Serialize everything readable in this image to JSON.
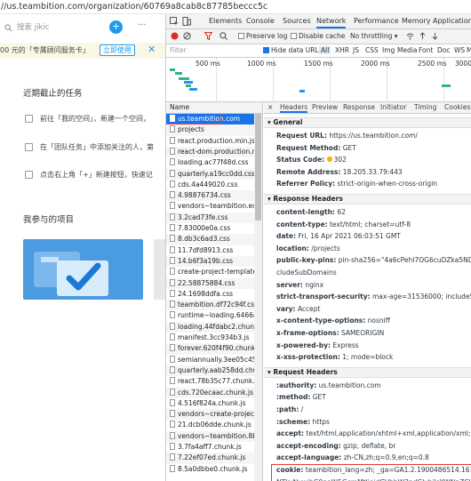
{
  "browser": {
    "url_fragment": "//us.teambition.com/organization/60769a8cab8c87785beccc5c"
  },
  "page": {
    "search_placeholder": "搜索 jikic",
    "plus_label": "+",
    "more_label": "···",
    "banner_text": "00 元的「专属顾问服务卡」",
    "banner_button": "立即使用",
    "banner_close": "✕",
    "recent_title": "近期截止的任务",
    "tasks": [
      "前往「我的空间」，新建一个空间，",
      "在「团队任务」中添加关注的人，第",
      "点击右上角「+」新建按钮，快速记"
    ],
    "projects_title": "我参与的项目"
  },
  "devtools": {
    "tabs": [
      "Elements",
      "Console",
      "Sources",
      "Network",
      "Performance",
      "Memory",
      "Application"
    ],
    "active_tab": "Network",
    "toolbar": {
      "preserve_log": "Preserve log",
      "disable_cache": "Disable cache",
      "throttle": "No throttling"
    },
    "filter": {
      "placeholder": "Filter",
      "hide_data_urls": "Hide data URLs",
      "types": [
        "All",
        "XHR",
        "JS",
        "CSS",
        "Img",
        "Media",
        "Font",
        "Doc",
        "WS",
        "M"
      ]
    },
    "timeline_ticks": [
      "500 ms",
      "1000 ms",
      "1500 ms",
      "2000 ms",
      "2500 ms",
      "3000"
    ],
    "name_header": "Name",
    "requests": [
      "us.teambition.com",
      "projects",
      "react.production.min.js",
      "react-dom.production.min",
      "loading.ac77f48d.css",
      "quarterly.a19cc0dd.css",
      "cds.4a449020.css",
      "4.98876734.css",
      "vendors~teambition.ec014",
      "3.2cad73fe.css",
      "7.83000e0a.css",
      "8.db3c6ad3.css",
      "11.7dfd8913.css",
      "14.b6f3a19b.css",
      "create-project-template~t",
      "22.58875884.css",
      "24.1698ddfa.css",
      "teambition.df72c94f.css",
      "runtime~loading.6466a0b.",
      "loading.44fdabc2.chunk.js",
      "manifest.3cc934b3.js",
      "forever.620f4f90.chunk.js",
      "semiannually.3ee05c45.ch",
      "quarterly.aab258dd.chunk.",
      "react.78b35c77.chunk.js",
      "cds.720ecaac.chunk.js",
      "4.516f824a.chunk.js",
      "vendors~create-project-te",
      "21.dcb06dde.chunk.js",
      "vendors~teambition.8b3f8",
      "3.7fa4aff7.chunk.js",
      "7.22ef07ed.chunk.js",
      "8.5a0dbbe0.chunk.js"
    ],
    "detail_tabs": [
      "Headers",
      "Preview",
      "Response",
      "Initiator",
      "Timing",
      "Cookies"
    ],
    "detail_close": "×",
    "general": {
      "title": "General",
      "rows": [
        {
          "k": "Request URL:",
          "v": "https://us.teambition.com/"
        },
        {
          "k": "Request Method:",
          "v": "GET"
        },
        {
          "k": "Status Code:",
          "v": "302"
        },
        {
          "k": "Remote Address:",
          "v": "18.205.33.79:443"
        },
        {
          "k": "Referrer Policy:",
          "v": "strict-origin-when-cross-origin"
        }
      ]
    },
    "response_headers": {
      "title": "Response Headers",
      "rows": [
        {
          "k": "content-length:",
          "v": "62"
        },
        {
          "k": "content-type:",
          "v": "text/html; charset=utf-8"
        },
        {
          "k": "date:",
          "v": "Fri, 16 Apr 2021 06:03:51 GMT"
        },
        {
          "k": "location:",
          "v": "/projects"
        },
        {
          "k": "public-key-pins:",
          "v": "pin-sha256=\"4a6cPehI7OG6cuDZka5NDZ7FR8a60"
        },
        {
          "k": "",
          "v": "cludeSubDomains"
        },
        {
          "k": "server:",
          "v": "nginx"
        },
        {
          "k": "strict-transport-security:",
          "v": "max-age=31536000; includeSubDomai"
        },
        {
          "k": "vary:",
          "v": "Accept"
        },
        {
          "k": "x-content-type-options:",
          "v": "nosniff"
        },
        {
          "k": "x-frame-options:",
          "v": "SAMEORIGIN"
        },
        {
          "k": "x-powered-by:",
          "v": "Express"
        },
        {
          "k": "x-xss-protection:",
          "v": "1; mode=block"
        }
      ]
    },
    "request_headers": {
      "title": "Request Headers",
      "rows": [
        {
          "k": ":authority:",
          "v": "us.teambition.com"
        },
        {
          "k": ":method:",
          "v": "GET"
        },
        {
          "k": ":path:",
          "v": "/"
        },
        {
          "k": ":scheme:",
          "v": "https"
        },
        {
          "k": "accept:",
          "v": "text/html,application/xhtml+xml,application/xml;"
        },
        {
          "k": "accept-encoding:",
          "v": "gzip, deflate, br"
        },
        {
          "k": "accept-language:",
          "v": "zh-CN,zh;q=0.9,en;q=0.8"
        },
        {
          "k": "cookie:",
          "v": "teambition_lang=zh; _ga=GA1.2.1900486514.1618541"
        },
        {
          "k": "",
          "v": "NTkyNywibG9naW5GcmMtIjoidGVhbW3pdGlvbiIsYWNpZCI6IjYwNzY"
        }
      ]
    },
    "colors": {
      "accent": "#1a73e8",
      "status_dot": "#f4b400",
      "highlight": "#e53935"
    }
  }
}
